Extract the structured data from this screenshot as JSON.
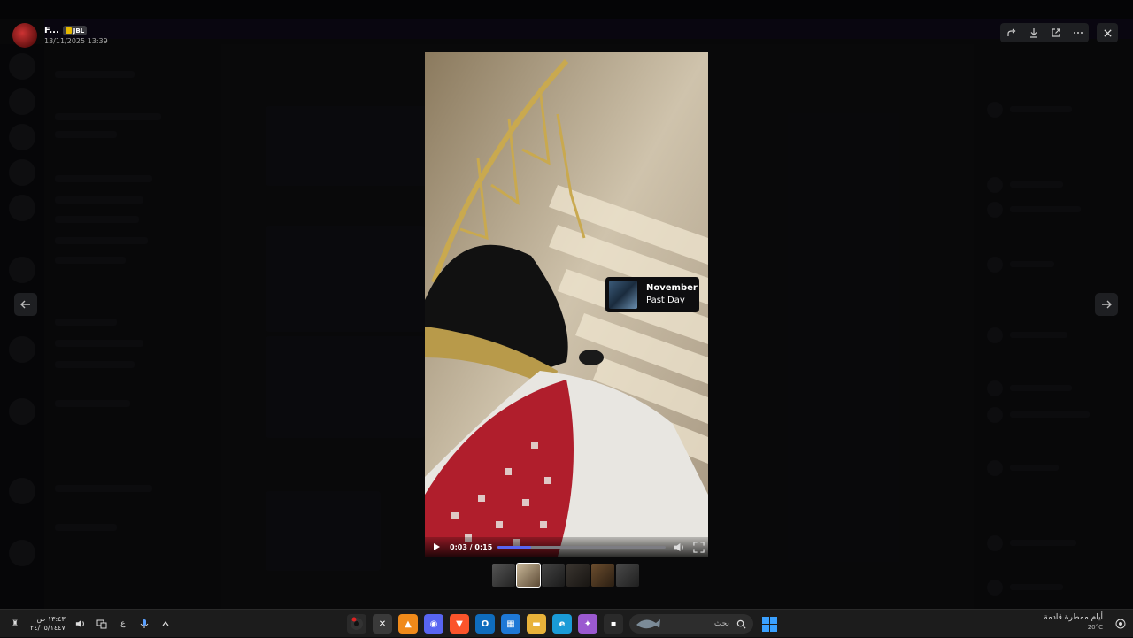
{
  "uploader": {
    "name": "F...",
    "badge": "JBL",
    "timestamp": "13/11/2025 13:39"
  },
  "media": {
    "sticker_title": "November",
    "sticker_subtitle": "Past Day",
    "time_display": "0:03 / 0:15",
    "progress_fraction": 0.2,
    "accent_color": "#5865f2"
  },
  "actions": {
    "icons": [
      "share-icon",
      "download-icon",
      "open-external-icon",
      "more-icon",
      "close-icon"
    ]
  },
  "thumbnails": {
    "count": 6,
    "selected_index": 1
  },
  "taskbar": {
    "clock_time": "١٣:٤٣ ص",
    "clock_date": "٢٤/٠٥/١٤٤٧",
    "lang": "ع",
    "search_placeholder": "بحث",
    "weather_text": "أيام ممطرة قادمة",
    "weather_temp": "20°C",
    "apps": [
      "discord-app",
      "capcut-app",
      "vlc-app",
      "discord-app",
      "brave-app",
      "outlook-app",
      "store-app",
      "explorer-app",
      "edge-app",
      "copilot-app",
      "app-generic"
    ]
  }
}
